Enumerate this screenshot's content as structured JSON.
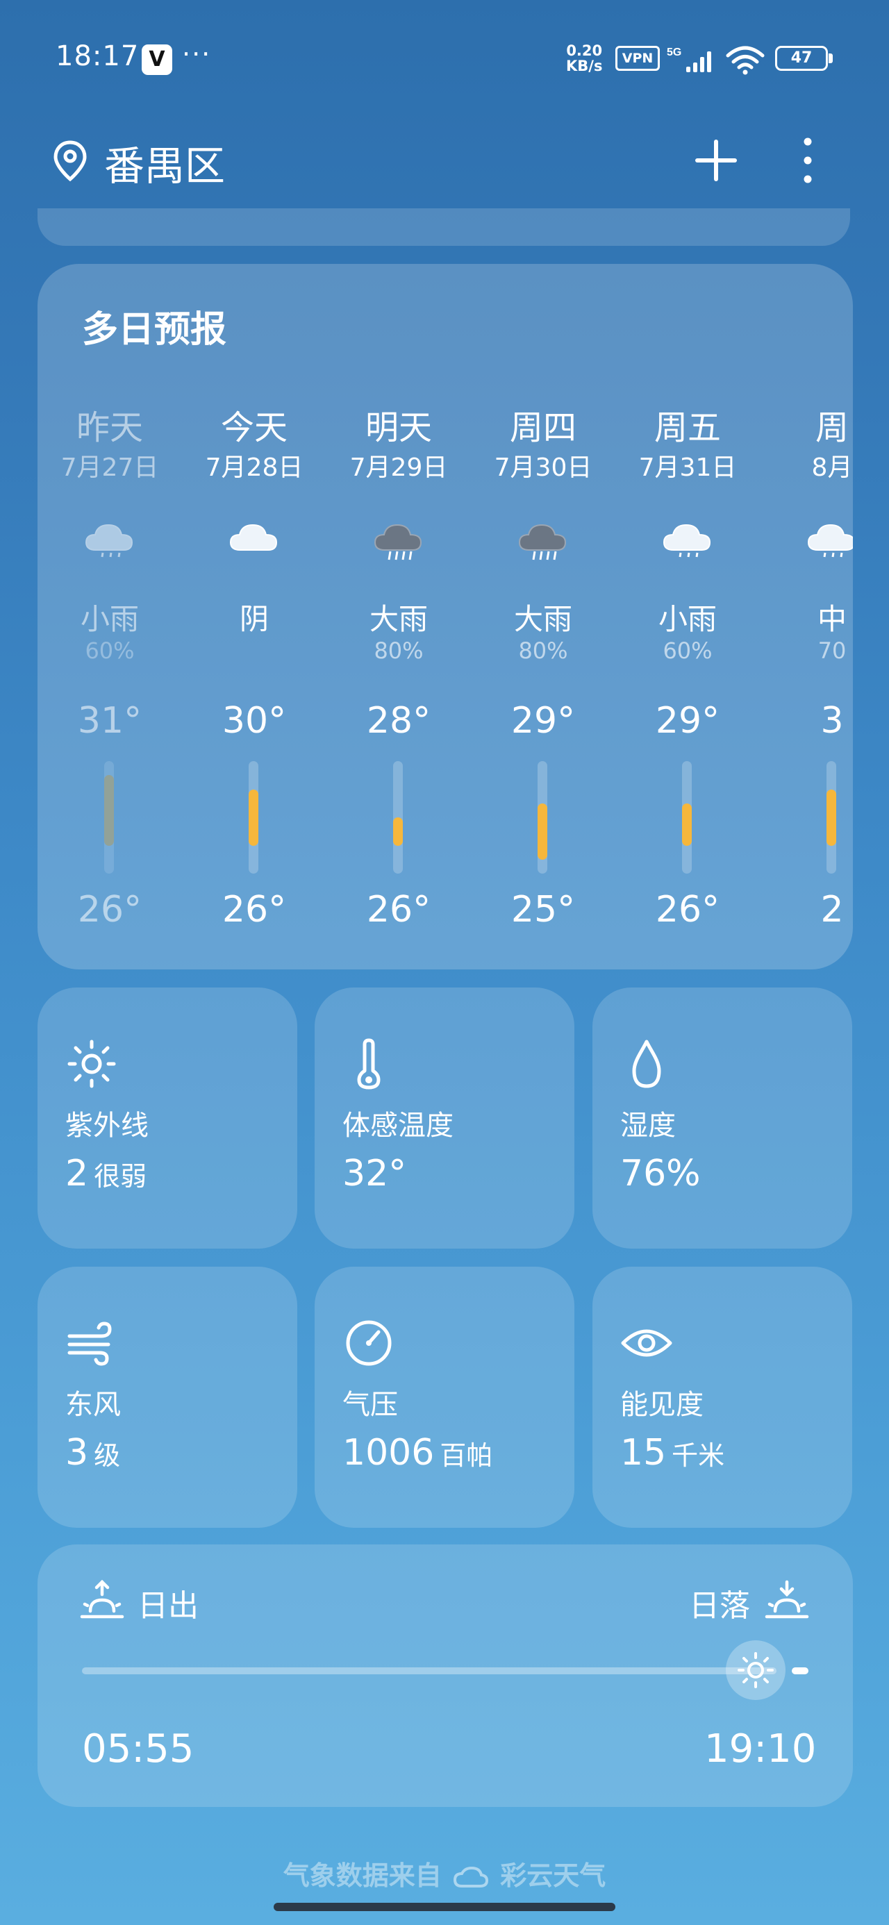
{
  "status_bar": {
    "time": "18:17",
    "app_icon": "V",
    "dots": "···",
    "net_speed_value": "0.20",
    "net_speed_unit": "KB/s",
    "vpn": "VPN",
    "network": "5G",
    "battery": "47"
  },
  "header": {
    "location": "番禺区",
    "add_icon": "plus-icon",
    "more_icon": "more-vertical-icon"
  },
  "forecast": {
    "title": "多日预报",
    "temp_scale_min": 24,
    "temp_scale_max": 32,
    "days": [
      {
        "name": "昨天",
        "date": "7月27日",
        "icon": "cloud-rain-icon",
        "condition": "小雨",
        "rain_prob": "60%",
        "high": "31°",
        "low": "26°",
        "high_v": 31,
        "low_v": 26,
        "past": true
      },
      {
        "name": "今天",
        "date": "7月28日",
        "icon": "cloud-icon",
        "condition": "阴",
        "rain_prob": "",
        "high": "30°",
        "low": "26°",
        "high_v": 30,
        "low_v": 26,
        "past": false
      },
      {
        "name": "明天",
        "date": "7月29日",
        "icon": "cloud-heavy-rain-icon",
        "condition": "大雨",
        "rain_prob": "80%",
        "high": "28°",
        "low": "26°",
        "high_v": 28,
        "low_v": 26,
        "past": false
      },
      {
        "name": "周四",
        "date": "7月30日",
        "icon": "cloud-heavy-rain-icon",
        "condition": "大雨",
        "rain_prob": "80%",
        "high": "29°",
        "low": "25°",
        "high_v": 29,
        "low_v": 25,
        "past": false
      },
      {
        "name": "周五",
        "date": "7月31日",
        "icon": "cloud-rain-icon",
        "condition": "小雨",
        "rain_prob": "60%",
        "high": "29°",
        "low": "26°",
        "high_v": 29,
        "low_v": 26,
        "past": false
      },
      {
        "name": "周",
        "date": "8月",
        "icon": "cloud-rain-icon",
        "condition": "中",
        "rain_prob": "70",
        "high": "3",
        "low": "2",
        "high_v": 30,
        "low_v": 26,
        "past": false
      }
    ]
  },
  "details": {
    "uv": {
      "icon": "sun-icon",
      "label": "紫外线",
      "value": "2",
      "unit": "很弱"
    },
    "feels_like": {
      "icon": "thermometer-icon",
      "label": "体感温度",
      "value": "32°",
      "unit": ""
    },
    "humidity": {
      "icon": "droplet-icon",
      "label": "湿度",
      "value": "76%",
      "unit": ""
    },
    "wind": {
      "icon": "wind-icon",
      "label": "东风",
      "value": "3",
      "unit": "级"
    },
    "pressure": {
      "icon": "gauge-icon",
      "label": "气压",
      "value": "1006",
      "unit": "百帕"
    },
    "visibility": {
      "icon": "eye-icon",
      "label": "能见度",
      "value": "15",
      "unit": "千米"
    }
  },
  "sun": {
    "sunrise_label": "日出",
    "sunset_label": "日落",
    "sunrise_time": "05:55",
    "sunset_time": "19:10",
    "progress": 0.96
  },
  "footer": {
    "source": "气象数据来自",
    "provider": "彩云天气"
  }
}
